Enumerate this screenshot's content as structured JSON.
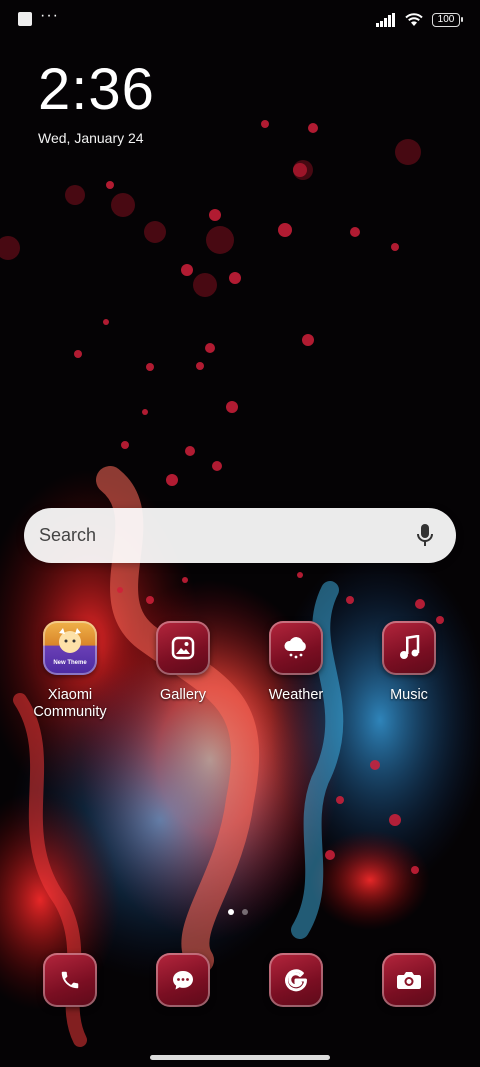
{
  "status_bar": {
    "battery_level": "100",
    "icons": [
      "notification-square-icon",
      "more-dots-icon",
      "signal-icon",
      "wifi-icon",
      "battery-icon"
    ]
  },
  "clock": {
    "time": "2:36",
    "date": "Wed, January 24"
  },
  "search": {
    "placeholder": "Search"
  },
  "apps": [
    {
      "label": "Xiaomi\nCommunity",
      "icon": "xiaomi-community-icon"
    },
    {
      "label": "Gallery",
      "icon": "gallery-icon"
    },
    {
      "label": "Weather",
      "icon": "weather-icon"
    },
    {
      "label": "Music",
      "icon": "music-icon"
    }
  ],
  "xiaomi_icon_text": "New Theme",
  "dock": [
    {
      "icon": "phone-icon"
    },
    {
      "icon": "messages-icon"
    },
    {
      "icon": "google-icon"
    },
    {
      "icon": "camera-icon"
    }
  ],
  "page_indicator": {
    "current": 1,
    "total": 2
  },
  "colors": {
    "icon_primary": "#b5263d",
    "icon_dark": "#5c0a19",
    "search_bg": "#f0f0f0"
  }
}
